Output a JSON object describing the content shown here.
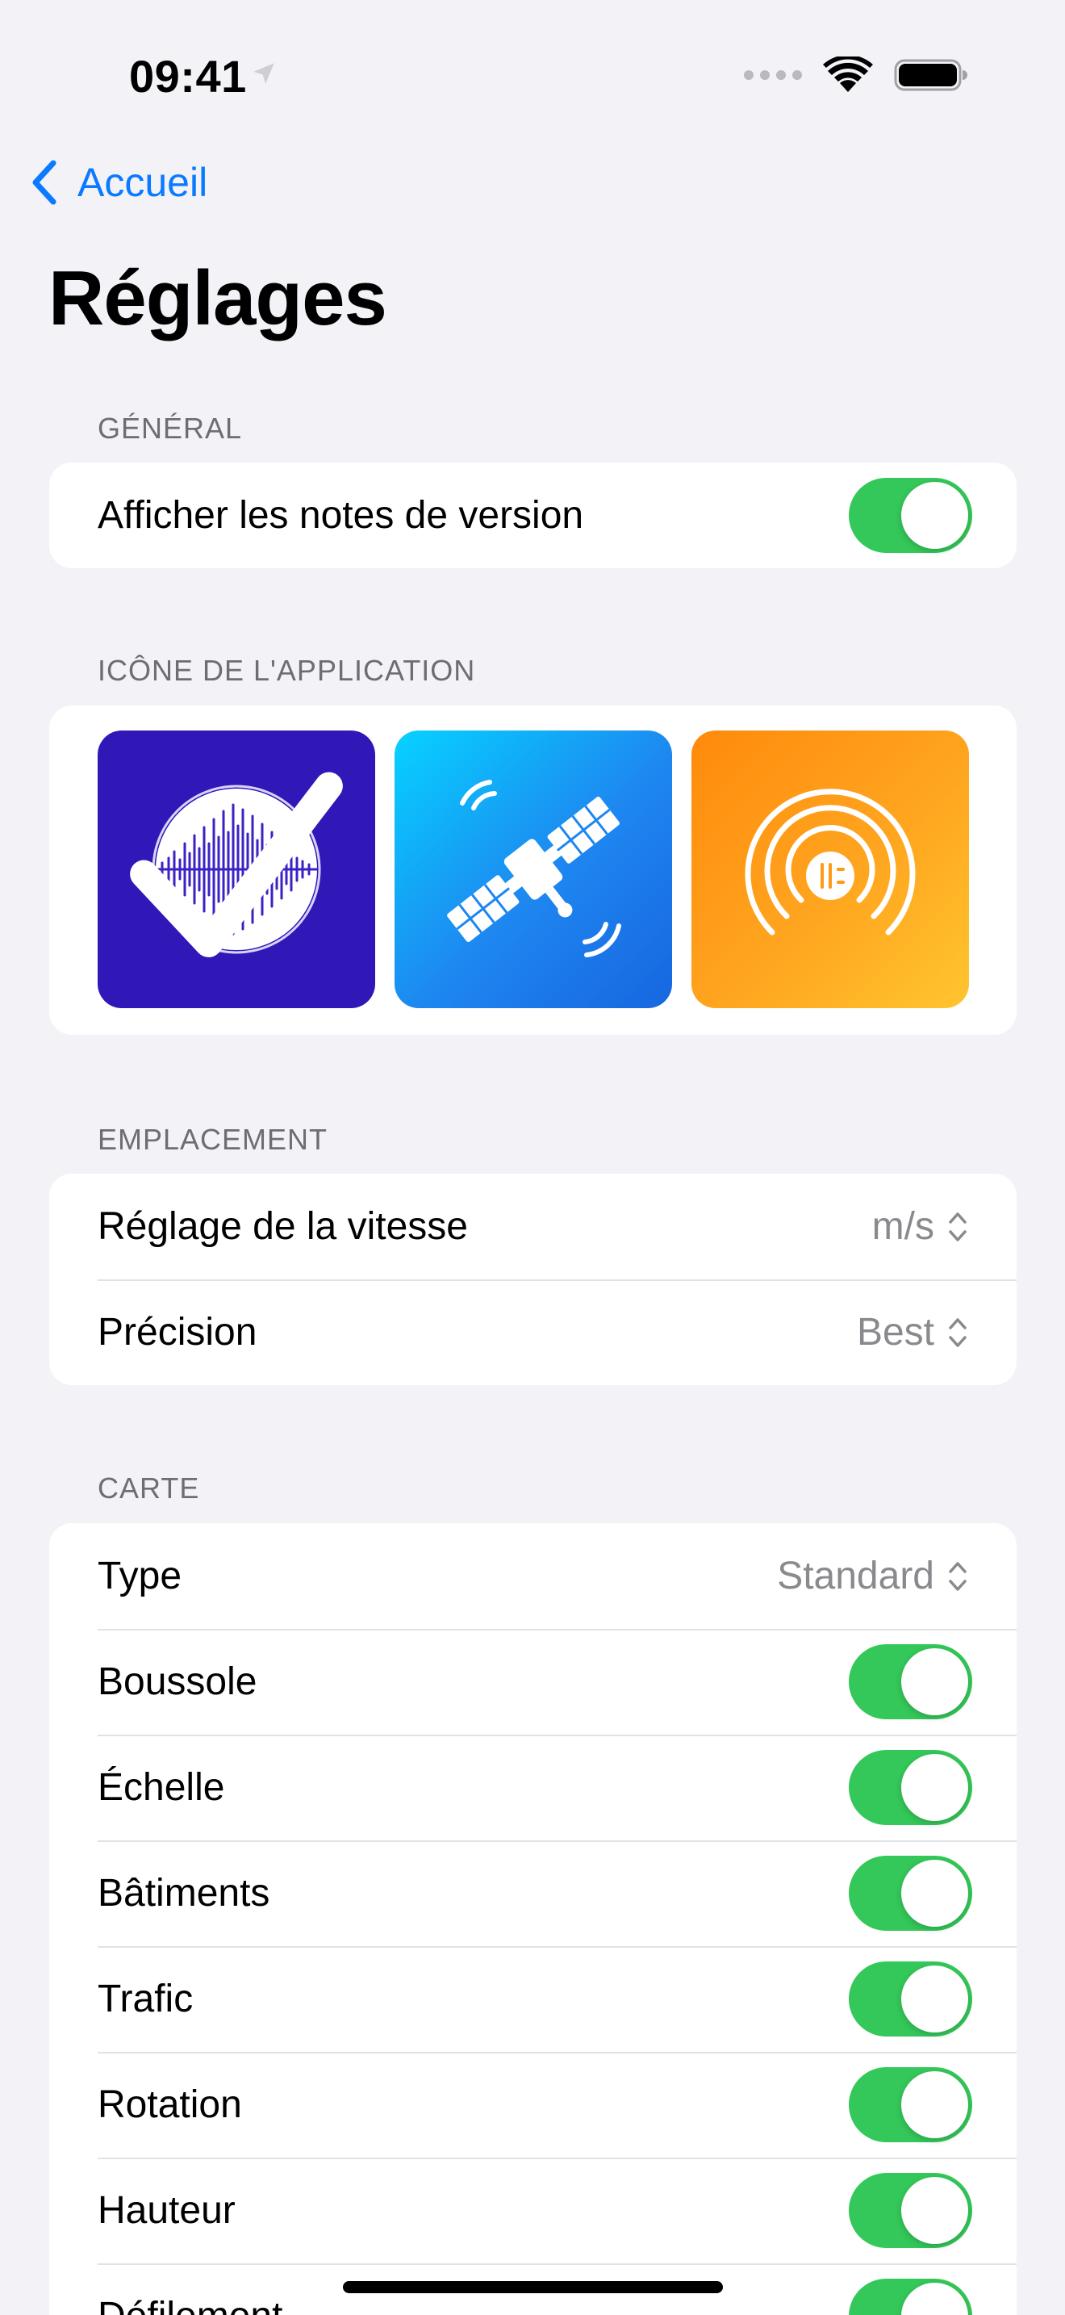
{
  "status_bar": {
    "time": "09:41"
  },
  "nav": {
    "back_label": "Accueil",
    "title": "Réglages"
  },
  "sections": {
    "general": {
      "header": "GÉNÉRAL",
      "release_notes_label": "Afficher les notes de version",
      "release_notes_on": true
    },
    "app_icon": {
      "header": "ICÔNE DE L'APPLICATION",
      "options": [
        "waveform-circle-icon",
        "satellite-icon",
        "broadcast-chip-icon"
      ],
      "selected_index": 0
    },
    "location": {
      "header": "EMPLACEMENT",
      "speed_label": "Réglage de la vitesse",
      "speed_value": "m/s",
      "accuracy_label": "Précision",
      "accuracy_value": "Best"
    },
    "map": {
      "header": "CARTE",
      "type_label": "Type",
      "type_value": "Standard",
      "compass_label": "Boussole",
      "scale_label": "Échelle",
      "buildings_label": "Bâtiments",
      "traffic_label": "Trafic",
      "rotation_label": "Rotation",
      "pitch_label": "Hauteur",
      "scroll_label": "Défilement",
      "all_toggles_on": true
    }
  },
  "colors": {
    "background": "#F2F2F7",
    "accent": "#0A7AFF",
    "toggle_on": "#34C759",
    "secondary_text": "#8A8A8E",
    "header_text": "#6D6D72"
  }
}
